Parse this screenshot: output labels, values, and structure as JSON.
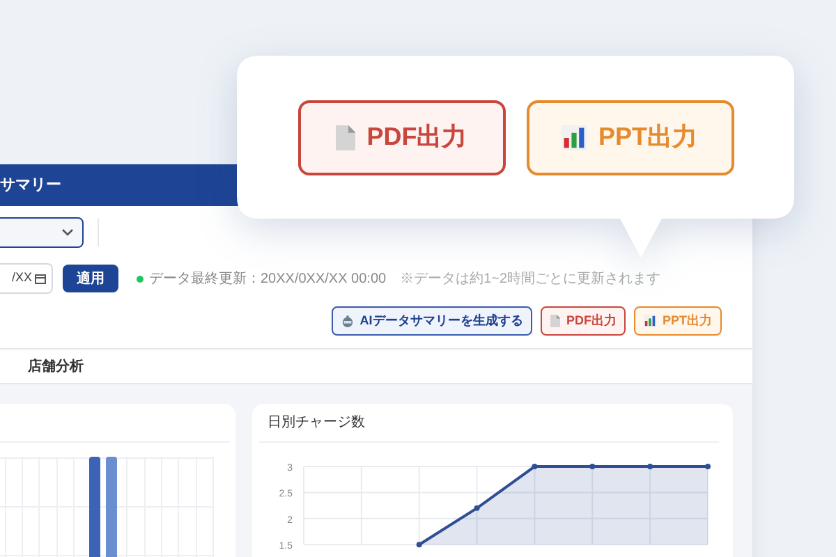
{
  "header": {
    "title": "サマリー"
  },
  "filters": {
    "date_value": "/XX",
    "apply_button": "適用",
    "status": {
      "text": "データ最終更新：20XX/0XX/XX 00:00",
      "color": "#22c55e"
    },
    "note": "※データは約1~2時間ごとに更新されます"
  },
  "actions": [
    {
      "label": "AIデータサマリーを生成する",
      "kind": "ai"
    },
    {
      "label": "PDF出力",
      "kind": "pdf"
    },
    {
      "label": "PPT出力",
      "kind": "ppt"
    }
  ],
  "tabs": [
    {
      "label": "店舗分析",
      "selected": false
    }
  ],
  "line_card": {
    "title": "日別チャージ数",
    "chart_data": {
      "type": "area",
      "series": [
        {
          "color": "#2f4f94",
          "values": [
            null,
            null,
            1.5,
            2.2,
            3,
            3,
            3,
            3
          ]
        }
      ],
      "ylim": [
        1.5,
        3
      ],
      "grid": true,
      "yticks": [
        {
          "value": 3,
          "label": "3"
        },
        {
          "value": 2.5,
          "label": "2.5"
        },
        {
          "value": 2,
          "label": "2"
        },
        {
          "value": 1.5,
          "label": "1.5"
        }
      ]
    }
  },
  "callout": {
    "buttons": [
      {
        "label": "PDF出力",
        "kind": "pdf"
      },
      {
        "label": "PPT出力",
        "kind": "ppt"
      }
    ]
  }
}
